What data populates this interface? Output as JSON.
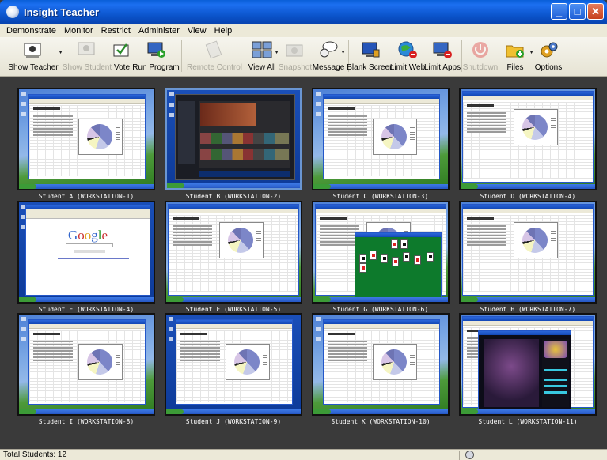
{
  "window": {
    "title": "Insight Teacher"
  },
  "menu": [
    "Demonstrate",
    "Monitor",
    "Restrict",
    "Administer",
    "View",
    "Help"
  ],
  "toolbar": [
    {
      "label": "Show Teacher",
      "icon": "presenter-icon",
      "enabled": true,
      "dropdown": true
    },
    {
      "label": "Show Student",
      "icon": "student-screen-icon",
      "enabled": false,
      "dropdown": false
    },
    {
      "label": "Vote",
      "icon": "vote-icon",
      "enabled": true,
      "dropdown": false
    },
    {
      "label": "Run Program",
      "icon": "run-program-icon",
      "enabled": true,
      "dropdown": false
    },
    {
      "label": "Remote Control",
      "icon": "remote-control-icon",
      "enabled": false,
      "dropdown": false
    },
    {
      "label": "View All",
      "icon": "view-all-icon",
      "enabled": true,
      "dropdown": true
    },
    {
      "label": "Snapshot",
      "icon": "snapshot-icon",
      "enabled": false,
      "dropdown": false
    },
    {
      "label": "Message",
      "icon": "message-icon",
      "enabled": true,
      "dropdown": true
    },
    {
      "label": "Blank Screen",
      "icon": "blank-screen-icon",
      "enabled": true,
      "dropdown": false
    },
    {
      "label": "Limit Web",
      "icon": "limit-web-icon",
      "enabled": true,
      "dropdown": false
    },
    {
      "label": "Limit Apps",
      "icon": "limit-apps-icon",
      "enabled": true,
      "dropdown": false
    },
    {
      "label": "Shutdown",
      "icon": "power-icon",
      "enabled": false,
      "dropdown": false
    },
    {
      "label": "Files",
      "icon": "folder-icon",
      "enabled": true,
      "dropdown": true
    },
    {
      "label": "Options",
      "icon": "gear-icon",
      "enabled": true,
      "dropdown": false
    }
  ],
  "students": [
    {
      "label": "Student A (WORKSTATION-1)",
      "screen": "excel",
      "bg": "xp",
      "selected": false
    },
    {
      "label": "Student B (WORKSTATION-2)",
      "screen": "media",
      "bg": "blue",
      "selected": true
    },
    {
      "label": "Student C (WORKSTATION-3)",
      "screen": "excel",
      "bg": "xp",
      "selected": false
    },
    {
      "label": "Student D (WORKSTATION-4)",
      "screen": "excel-full",
      "bg": "xp",
      "selected": false
    },
    {
      "label": "Student E (WORKSTATION-4)",
      "screen": "google",
      "bg": "blue",
      "selected": false
    },
    {
      "label": "Student F (WORKSTATION-5)",
      "screen": "excel-full",
      "bg": "xp",
      "selected": false
    },
    {
      "label": "Student G (WORKSTATION-6)",
      "screen": "solitaire",
      "bg": "xp",
      "selected": false
    },
    {
      "label": "Student H (WORKSTATION-7)",
      "screen": "excel-full",
      "bg": "xp",
      "selected": false
    },
    {
      "label": "Student I (WORKSTATION-8)",
      "screen": "excel",
      "bg": "xp",
      "selected": false
    },
    {
      "label": "Student J (WORKSTATION-9)",
      "screen": "excel",
      "bg": "blue",
      "selected": false
    },
    {
      "label": "Student K (WORKSTATION-10)",
      "screen": "excel",
      "bg": "xp",
      "selected": false
    },
    {
      "label": "Student L (WORKSTATION-11)",
      "screen": "pinball",
      "bg": "xp",
      "selected": false
    }
  ],
  "status": {
    "total": "Total Students: 12"
  },
  "google": {
    "logo": "Google"
  }
}
